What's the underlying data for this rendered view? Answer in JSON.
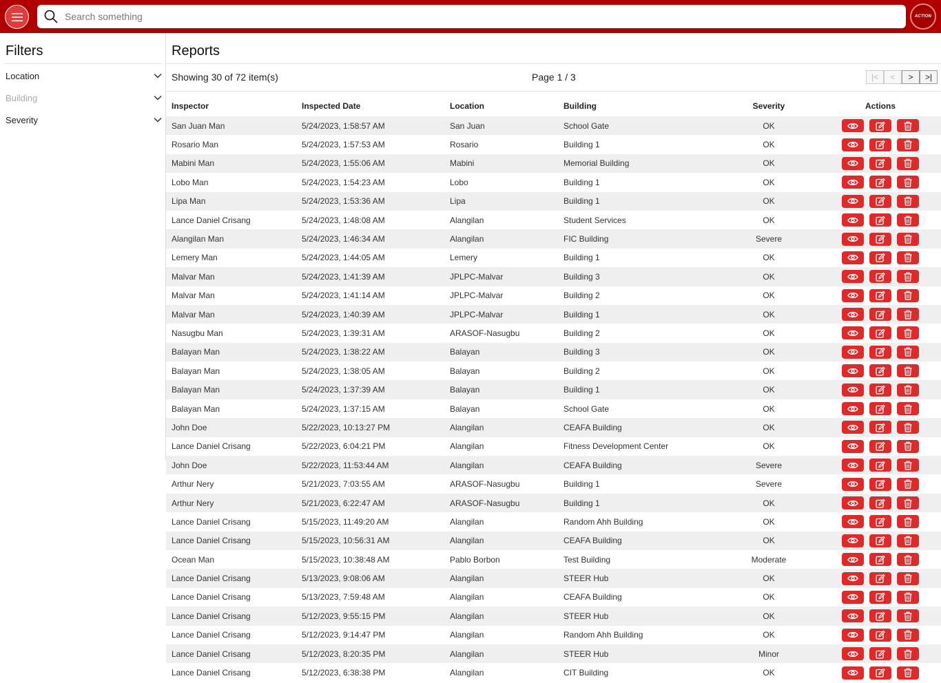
{
  "topbar": {
    "search_placeholder": "Search something",
    "logo_text": "ACTION"
  },
  "sidebar": {
    "title": "Filters",
    "filters": [
      {
        "label": "Location",
        "disabled": false
      },
      {
        "label": "Building",
        "disabled": true
      },
      {
        "label": "Severity",
        "disabled": false
      }
    ]
  },
  "main": {
    "title": "Reports",
    "showing": "Showing 30 of 72 item(s)",
    "page": "Page 1 / 3",
    "pager": {
      "first": "|<",
      "prev": "<",
      "next": ">",
      "last": ">|"
    },
    "columns": [
      "Inspector",
      "Inspected Date",
      "Location",
      "Building",
      "Severity",
      "Actions"
    ],
    "rows": [
      [
        "San Juan Man",
        "5/24/2023, 1:58:57 AM",
        "San Juan",
        "School Gate",
        "OK"
      ],
      [
        "Rosario Man",
        "5/24/2023, 1:57:53 AM",
        "Rosario",
        "Building 1",
        "OK"
      ],
      [
        "Mabini Man",
        "5/24/2023, 1:55:06 AM",
        "Mabini",
        "Memorial Building",
        "OK"
      ],
      [
        "Lobo Man",
        "5/24/2023, 1:54:23 AM",
        "Lobo",
        "Building 1",
        "OK"
      ],
      [
        "Lipa Man",
        "5/24/2023, 1:53:36 AM",
        "Lipa",
        "Building 1",
        "OK"
      ],
      [
        "Lance Daniel Crisang",
        "5/24/2023, 1:48:08 AM",
        "Alangilan",
        "Student Services",
        "OK"
      ],
      [
        "Alangilan Man",
        "5/24/2023, 1:46:34 AM",
        "Alangilan",
        "FIC Building",
        "Severe"
      ],
      [
        "Lemery Man",
        "5/24/2023, 1:44:05 AM",
        "Lemery",
        "Building 1",
        "OK"
      ],
      [
        "Malvar Man",
        "5/24/2023, 1:41:39 AM",
        "JPLPC-Malvar",
        "Building 3",
        "OK"
      ],
      [
        "Malvar Man",
        "5/24/2023, 1:41:14 AM",
        "JPLPC-Malvar",
        "Building 2",
        "OK"
      ],
      [
        "Malvar Man",
        "5/24/2023, 1:40:39 AM",
        "JPLPC-Malvar",
        "Building 1",
        "OK"
      ],
      [
        "Nasugbu Man",
        "5/24/2023, 1:39:31 AM",
        "ARASOF-Nasugbu",
        "Building 2",
        "OK"
      ],
      [
        "Balayan Man",
        "5/24/2023, 1:38:22 AM",
        "Balayan",
        "Building 3",
        "OK"
      ],
      [
        "Balayan Man",
        "5/24/2023, 1:38:05 AM",
        "Balayan",
        "Building 2",
        "OK"
      ],
      [
        "Balayan Man",
        "5/24/2023, 1:37:39 AM",
        "Balayan",
        "Building 1",
        "OK"
      ],
      [
        "Balayan Man",
        "5/24/2023, 1:37:15 AM",
        "Balayan",
        "School Gate",
        "OK"
      ],
      [
        "John Doe",
        "5/22/2023, 10:13:27 PM",
        "Alangilan",
        "CEAFA Building",
        "OK"
      ],
      [
        "Lance Daniel Crisang",
        "5/22/2023, 6:04:21 PM",
        "Alangilan",
        "Fitness Development Center",
        "OK"
      ],
      [
        "John Doe",
        "5/22/2023, 11:53:44 AM",
        "Alangilan",
        "CEAFA Building",
        "Severe"
      ],
      [
        "Arthur Nery",
        "5/21/2023, 7:03:55 AM",
        "ARASOF-Nasugbu",
        "Building 1",
        "Severe"
      ],
      [
        "Arthur Nery",
        "5/21/2023, 6:22:47 AM",
        "ARASOF-Nasugbu",
        "Building 1",
        "OK"
      ],
      [
        "Lance Daniel Crisang",
        "5/15/2023, 11:49:20 AM",
        "Alangilan",
        "Random Ahh Building",
        "OK"
      ],
      [
        "Lance Daniel Crisang",
        "5/15/2023, 10:56:31 AM",
        "Alangilan",
        "CEAFA Building",
        "OK"
      ],
      [
        "Ocean Man",
        "5/15/2023, 10:38:48 AM",
        "Pablo Borbon",
        "Test Building",
        "Moderate"
      ],
      [
        "Lance Daniel Crisang",
        "5/13/2023, 9:08:06 AM",
        "Alangilan",
        "STEER Hub",
        "OK"
      ],
      [
        "Lance Daniel Crisang",
        "5/13/2023, 7:59:48 AM",
        "Alangilan",
        "CEAFA Building",
        "OK"
      ],
      [
        "Lance Daniel Crisang",
        "5/12/2023, 9:55:15 PM",
        "Alangilan",
        "STEER Hub",
        "OK"
      ],
      [
        "Lance Daniel Crisang",
        "5/12/2023, 9:14:47 PM",
        "Alangilan",
        "Random Ahh Building",
        "OK"
      ],
      [
        "Lance Daniel Crisang",
        "5/12/2023, 8:20:35 PM",
        "Alangilan",
        "STEER Hub",
        "Minor"
      ],
      [
        "Lance Daniel Crisang",
        "5/12/2023, 6:38:38 PM",
        "Alangilan",
        "CIT Building",
        "OK"
      ]
    ],
    "row_actions": [
      "eye-icon",
      "edit-icon",
      "trash-icon"
    ]
  },
  "colors": {
    "brand": "#b00000",
    "action_button": "#dd2a2a",
    "row_stripe": "#efefef"
  }
}
